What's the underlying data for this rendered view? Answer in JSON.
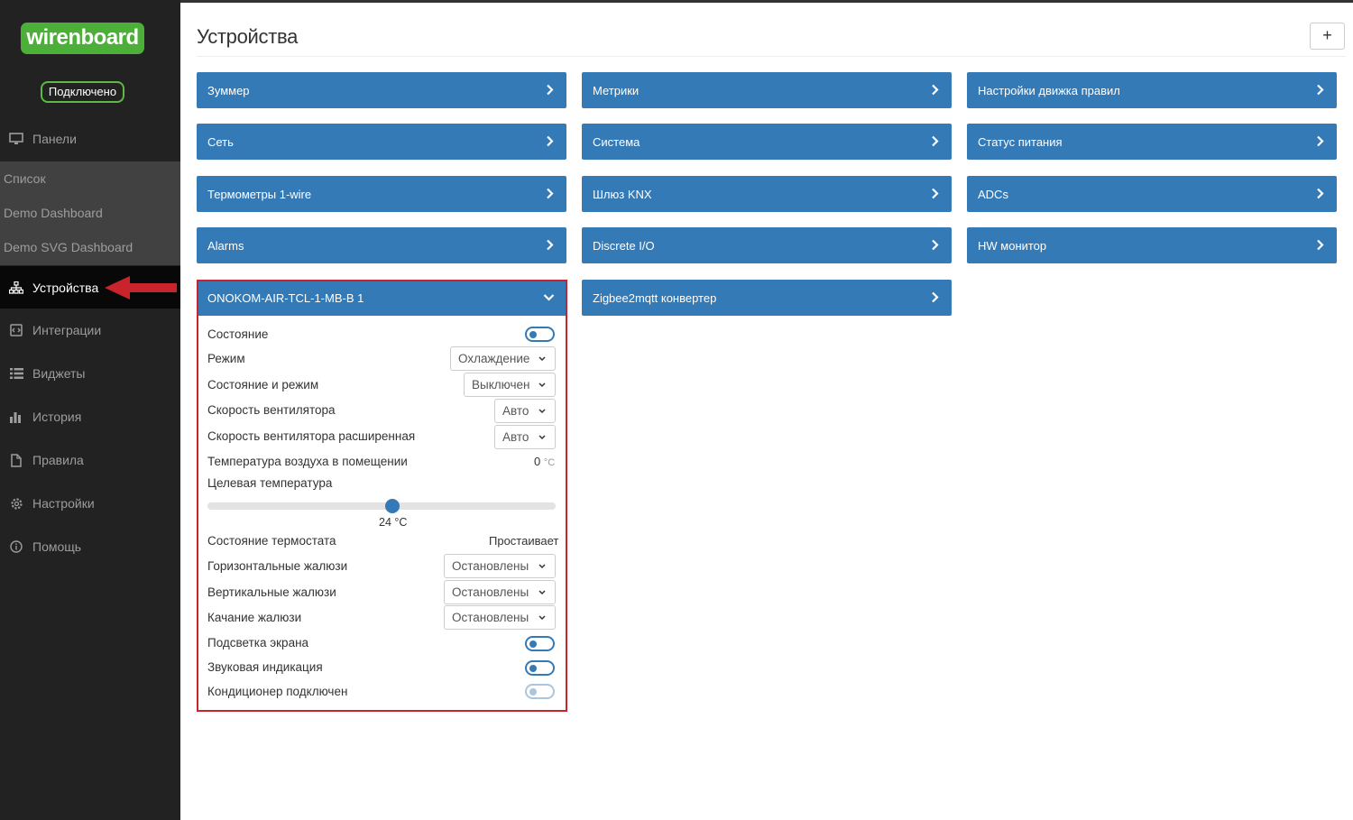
{
  "sidebar": {
    "logo": "wirenboard",
    "status": "Подключено",
    "items": [
      {
        "label": "Панели",
        "icon": "monitor-icon"
      },
      {
        "label": "Устройства",
        "icon": "sitemap-icon"
      },
      {
        "label": "Интеграции",
        "icon": "integration-icon"
      },
      {
        "label": "Виджеты",
        "icon": "list-icon"
      },
      {
        "label": "История",
        "icon": "bar-chart-icon"
      },
      {
        "label": "Правила",
        "icon": "file-icon"
      },
      {
        "label": "Настройки",
        "icon": "gear-icon"
      },
      {
        "label": "Помощь",
        "icon": "info-icon"
      }
    ],
    "subitems": [
      "Список",
      "Demo Dashboard",
      "Demo SVG Dashboard"
    ]
  },
  "header": {
    "title": "Устройства",
    "add_button": "+"
  },
  "devices": {
    "col1": [
      "Зуммер",
      "Сеть",
      "Термометры 1-wire",
      "Alarms"
    ],
    "col2": [
      "Метрики",
      "Система",
      "Шлюз KNX",
      "Discrete I/O",
      "Zigbee2mqtt конвертер"
    ],
    "col3": [
      "Настройки движка правил",
      "Статус питания",
      "ADCs",
      "HW монитор"
    ]
  },
  "device_panel": {
    "title": "ONOKOM-AIR-TCL-1-MB-B 1",
    "state_label": "Состояние",
    "mode_label": "Режим",
    "mode_value": "Охлаждение",
    "state_mode_label": "Состояние и режим",
    "state_mode_value": "Выключен",
    "fan_label": "Скорость вентилятора",
    "fan_value": "Авто",
    "fan_ext_label": "Скорость вентилятора расширенная",
    "fan_ext_value": "Авто",
    "room_temp_label": "Температура воздуха в помещении",
    "room_temp_value": "0",
    "room_temp_unit": "°C",
    "target_temp_label": "Целевая температура",
    "target_temp_value": "24 °C",
    "target_temp_fraction": 0.53,
    "thermostat_label": "Состояние термостата",
    "thermostat_value": "Простаивает",
    "hblinds_label": "Горизонтальные жалюзи",
    "hblinds_value": "Остановлены",
    "vblinds_label": "Вертикальные жалюзи",
    "vblinds_value": "Остановлены",
    "swing_label": "Качание жалюзи",
    "swing_value": "Остановлены",
    "backlight_label": "Подсветка экрана",
    "sound_label": "Звуковая индикация",
    "connected_label": "Кондиционер подключен"
  },
  "colors": {
    "sidebar_bg": "#222222",
    "card_blue": "#337ab7",
    "logo_green": "#4caf38",
    "highlight_red": "#c9232c"
  }
}
